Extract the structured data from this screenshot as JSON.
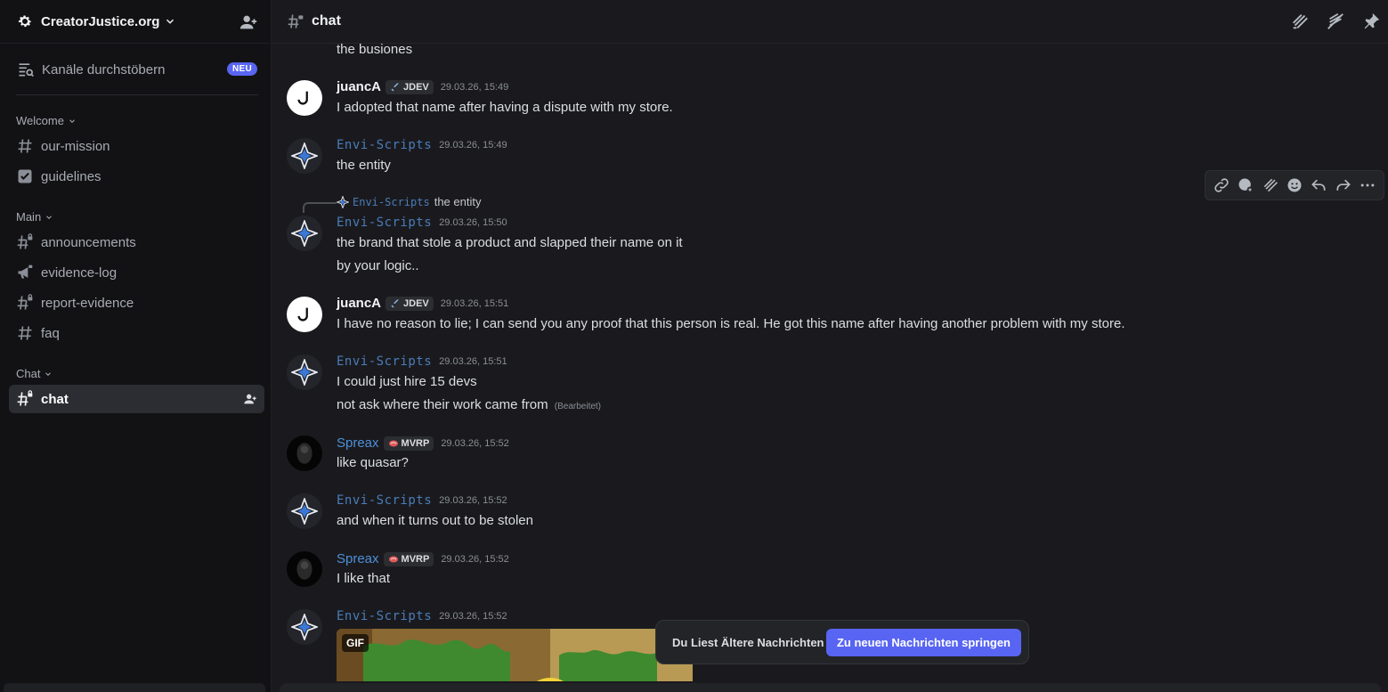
{
  "server": {
    "name": "CreatorJustice.org"
  },
  "browse": {
    "label": "Kanäle durchstöbern",
    "badge": "NEU"
  },
  "categories": [
    {
      "label": "Welcome",
      "channels": [
        {
          "label": "our-mission",
          "icon": "hash-icon"
        },
        {
          "label": "guidelines",
          "icon": "checklist-icon"
        }
      ]
    },
    {
      "label": "Main",
      "channels": [
        {
          "label": "announcements",
          "icon": "hash-lock-icon"
        },
        {
          "label": "evidence-log",
          "icon": "megaphone-icon"
        },
        {
          "label": "report-evidence",
          "icon": "hash-lock-icon"
        },
        {
          "label": "faq",
          "icon": "hash-icon"
        }
      ]
    },
    {
      "label": "Chat",
      "channels": [
        {
          "label": "chat",
          "icon": "hash-lock-icon",
          "active": true
        }
      ]
    }
  ],
  "topbar": {
    "channel": "chat"
  },
  "messages": {
    "m0": {
      "text": "the busiones"
    },
    "m1": {
      "user": "juancA",
      "tag": "JDEV",
      "time": "29.03.26, 15:49",
      "text": "I adopted that name after having a dispute with my store."
    },
    "m2": {
      "user": "Envi-Scripts",
      "time": "29.03.26, 15:49",
      "text": "the entity"
    },
    "m3": {
      "reply_user": "Envi-Scripts",
      "reply_text": "the entity",
      "user": "Envi-Scripts",
      "time": "29.03.26, 15:50",
      "text1": "the brand that stole a product and slapped their name on it",
      "text2": "by your logic.."
    },
    "m4": {
      "user": "juancA",
      "tag": "JDEV",
      "time": "29.03.26, 15:51",
      "text": "I have no reason to lie; I can send you any proof that this person is real. He got this name after having another problem with my store."
    },
    "m5": {
      "user": "Envi-Scripts",
      "time": "29.03.26, 15:51",
      "text1": "I could just hire 15 devs",
      "text2": "not ask where their work came from",
      "edited": "(Bearbeitet)"
    },
    "m6": {
      "user": "Spreax",
      "tag": "MVRP",
      "time": "29.03.26, 15:52",
      "text": "like quasar?"
    },
    "m7": {
      "user": "Envi-Scripts",
      "time": "29.03.26, 15:52",
      "text": "and when it turns out to be stolen"
    },
    "m8": {
      "user": "Spreax",
      "tag": "MVRP",
      "time": "29.03.26, 15:52",
      "text": "I like that"
    },
    "m9": {
      "user": "Envi-Scripts",
      "time": "29.03.26, 15:52",
      "gif_badge": "GIF"
    }
  },
  "older_banner": {
    "text": "Du Liest Ältere Nachrichten",
    "button": "Zu neuen Nachrichten springen"
  },
  "colors": {
    "accent": "#5865f2",
    "envi_name": "#4a7cb8",
    "spreax_name": "#4d90d8"
  }
}
